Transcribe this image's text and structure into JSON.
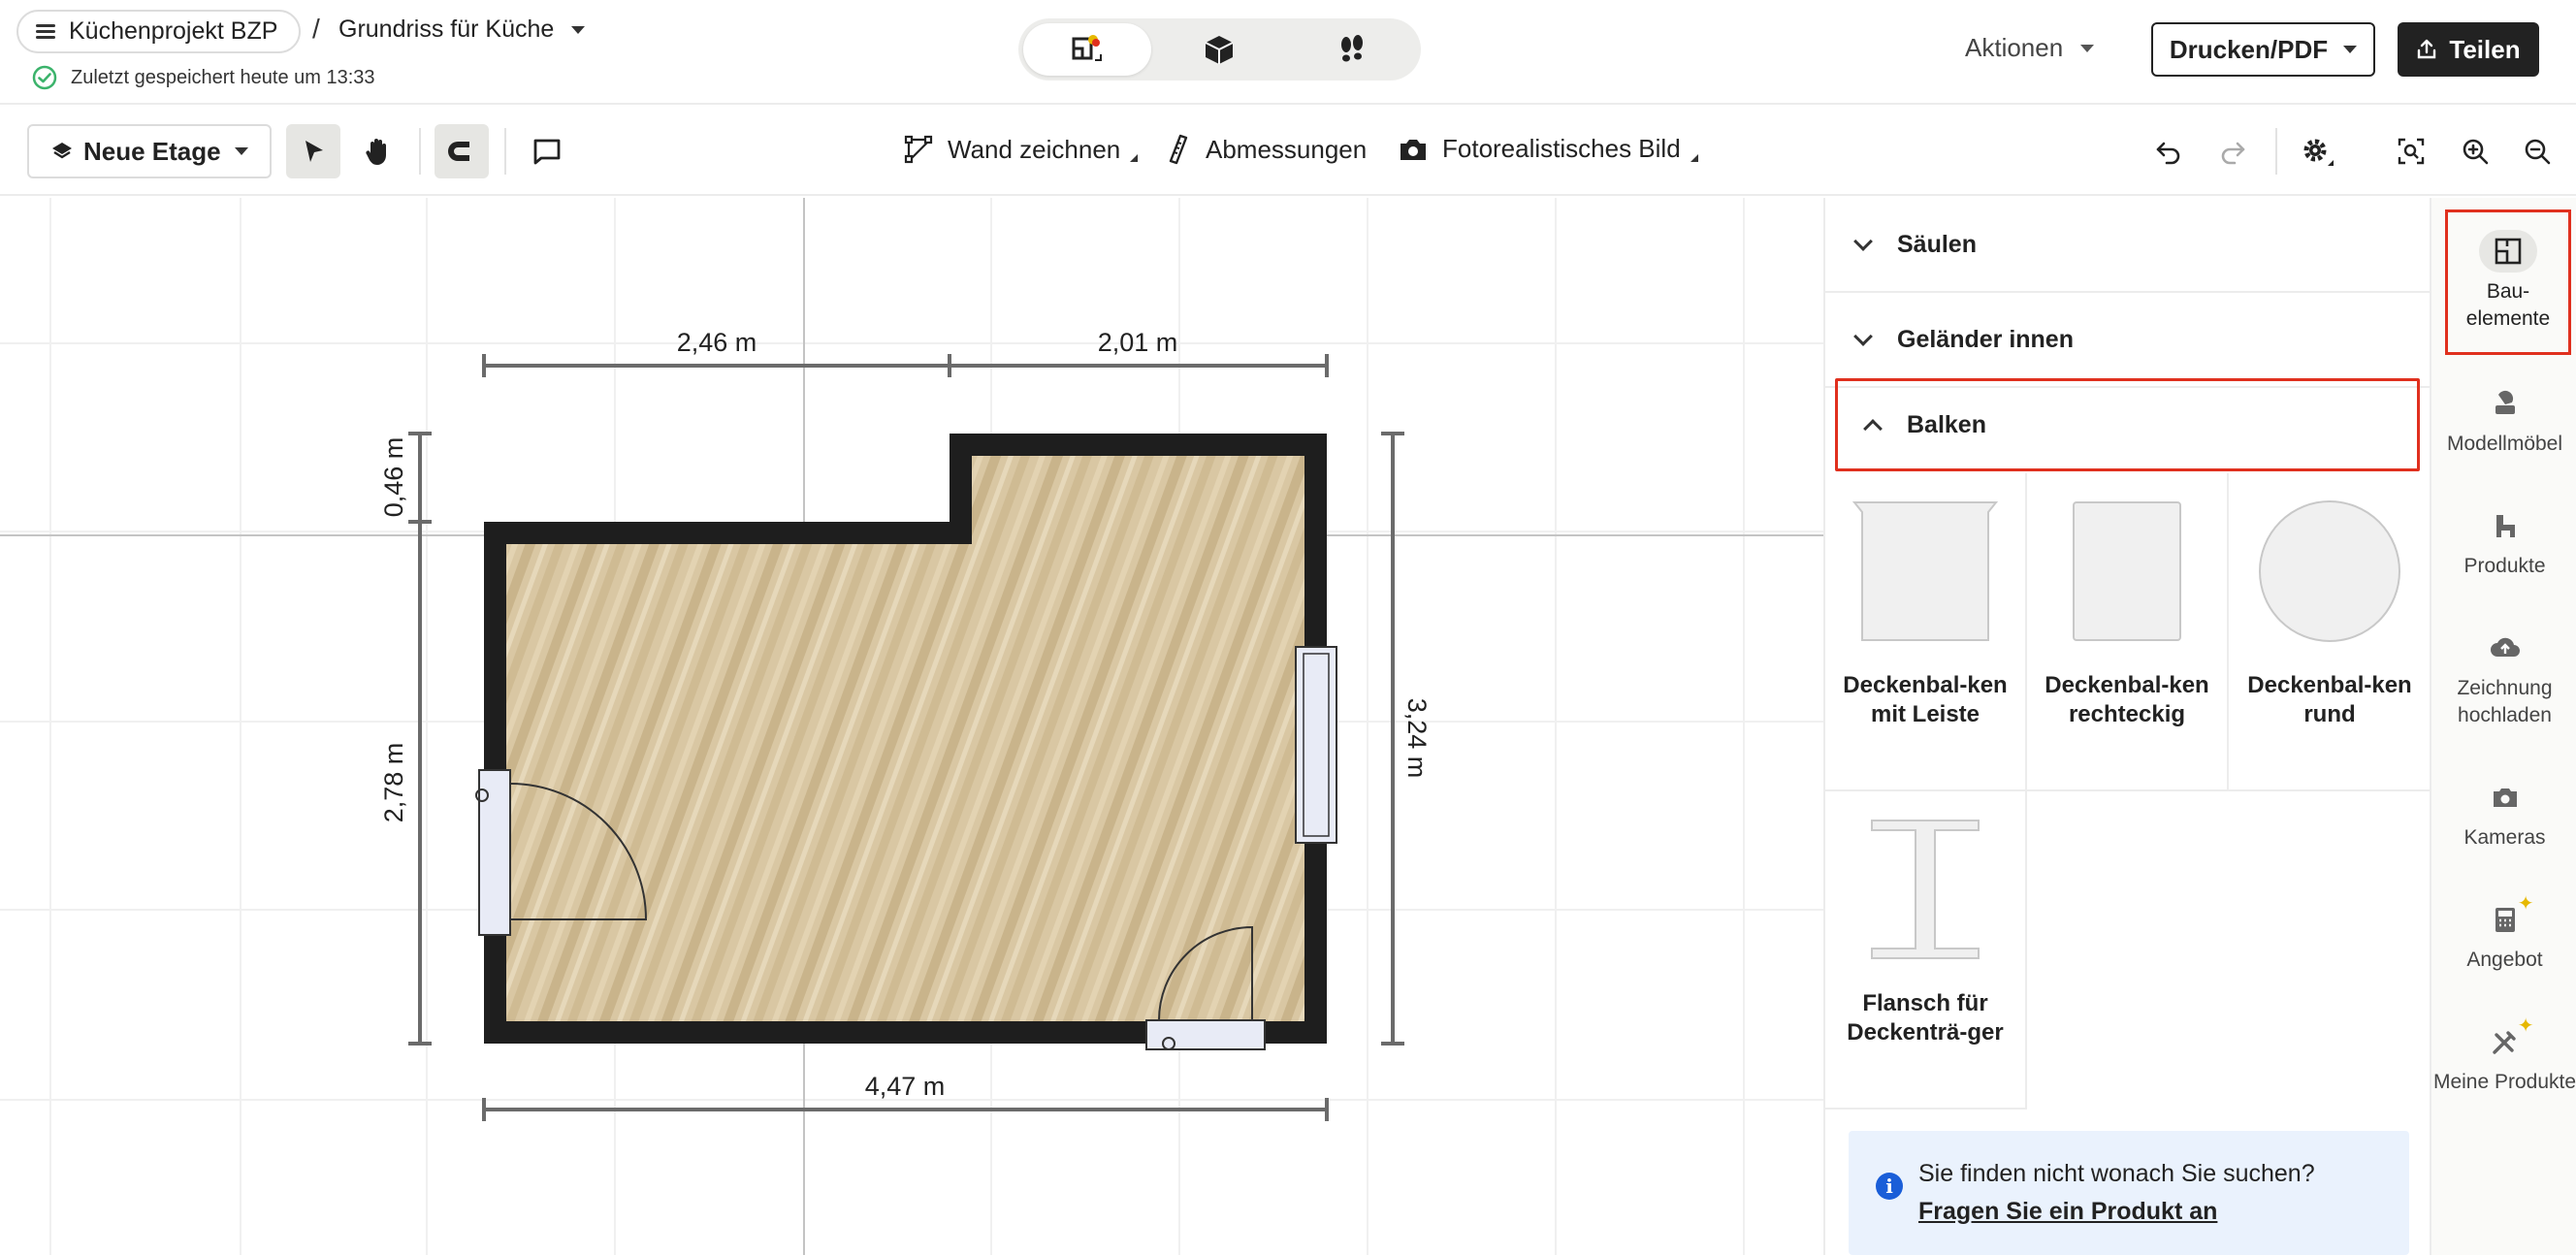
{
  "header": {
    "project_name": "Küchenprojekt BZP",
    "separator": "/",
    "plan_name": "Grundriss für Küche",
    "saved_status": "Zuletzt gespeichert heute um 13:33",
    "actions_label": "Aktionen",
    "print_label": "Drucken/PDF",
    "share_label": "Teilen"
  },
  "toolbar": {
    "floor_label": "Neue Etage",
    "draw_wall_label": "Wand zeichnen",
    "dimensions_label": "Abmessungen",
    "photo_label": "Fotorealistisches Bild"
  },
  "floorplan": {
    "dim_top_left": "2,46 m",
    "dim_top_right": "2,01 m",
    "dim_bottom": "4,47 m",
    "dim_left_top": "0,46 m",
    "dim_left_main": "2,78 m",
    "dim_right": "3,24 m",
    "colors": {
      "wall": "#1e1e1e",
      "floor": "#d8c6a0",
      "dimension": "#6b6b6b"
    }
  },
  "panel": {
    "sections": [
      {
        "label": "Säulen",
        "expanded": false
      },
      {
        "label": "Geländer innen",
        "expanded": false
      },
      {
        "label": "Balken",
        "expanded": true
      }
    ],
    "items": [
      {
        "label": "Deckenbal-ken mit Leiste",
        "icon": "beam-with-strip-icon"
      },
      {
        "label": "Deckenbal-ken rechteckig",
        "icon": "beam-rectangular-icon"
      },
      {
        "label": "Deckenbal-ken rund",
        "icon": "beam-round-icon"
      },
      {
        "label": "Flansch für Deckenträ-ger",
        "icon": "flange-beam-icon"
      }
    ],
    "info": {
      "question": "Sie finden nicht wonach Sie suchen?",
      "link": "Fragen Sie ein Produkt an"
    }
  },
  "rail": {
    "items": [
      {
        "label": "Bau-elemente",
        "icon": "building-elements-icon",
        "active": true
      },
      {
        "label": "Modellmöbel",
        "icon": "model-furniture-icon"
      },
      {
        "label": "Produkte",
        "icon": "products-icon"
      },
      {
        "label": "Zeichnung hochladen",
        "icon": "upload-drawing-icon"
      },
      {
        "label": "Kameras",
        "icon": "camera-icon"
      },
      {
        "label": "Angebot",
        "icon": "calculator-icon"
      },
      {
        "label": "Meine Produkte",
        "icon": "my-products-icon"
      }
    ]
  }
}
